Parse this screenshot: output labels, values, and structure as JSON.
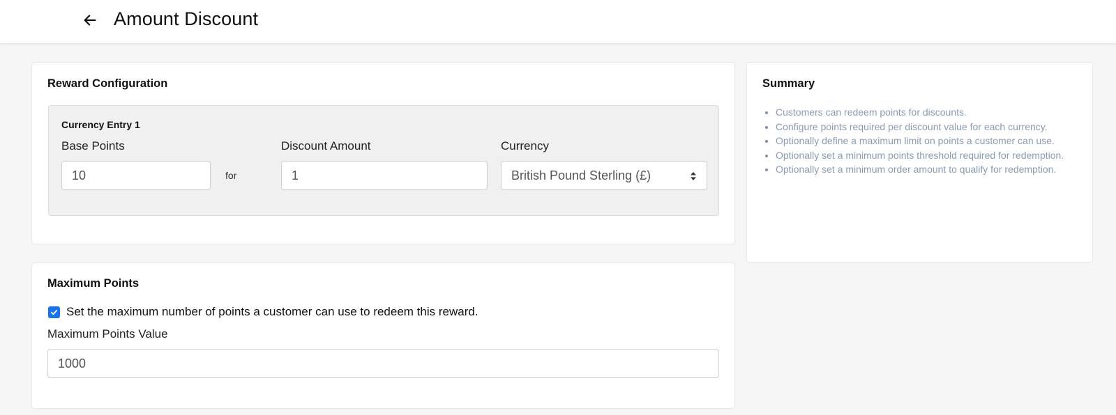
{
  "header": {
    "title": "Amount Discount",
    "back_icon": "arrow-left-icon"
  },
  "reward_config": {
    "heading": "Reward Configuration",
    "entry": {
      "title": "Currency Entry 1",
      "base_points_label": "Base Points",
      "base_points_value": "10",
      "for_text": "for",
      "discount_amount_label": "Discount Amount",
      "discount_amount_value": "1",
      "currency_label": "Currency",
      "currency_value": "British Pound Sterling (£)"
    }
  },
  "summary": {
    "heading": "Summary",
    "items": [
      "Customers can redeem points for discounts.",
      "Configure points required per discount value for each currency.",
      "Optionally define a maximum limit on points a customer can use.",
      "Optionally set a minimum points threshold required for redemption.",
      "Optionally set a minimum order amount to qualify for redemption."
    ]
  },
  "max_points": {
    "heading": "Maximum Points",
    "checkbox_label": "Set the maximum number of points a customer can use to redeem this reward.",
    "checkbox_checked": true,
    "value_label": "Maximum Points Value",
    "value": "1000"
  },
  "colors": {
    "accent": "#1a73e8",
    "summary_text": "#8a9bb3"
  }
}
